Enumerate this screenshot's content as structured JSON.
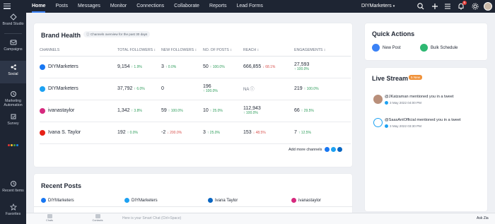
{
  "app": {
    "nav": [
      "Home",
      "Posts",
      "Messages",
      "Monitor",
      "Connections",
      "Collaborate",
      "Reports",
      "Lead Forms"
    ],
    "brand": "DIYMarketers",
    "notification_count": "5",
    "accent": "#3b82f6"
  },
  "sidebar": {
    "items": [
      {
        "label": "Brand Studio",
        "icon": "brand-studio-icon"
      },
      {
        "label": "Campaigns",
        "icon": "campaigns-icon"
      },
      {
        "label": "Social",
        "icon": "social-icon"
      },
      {
        "label": "Marketing Automation",
        "icon": "marketing-automation-icon"
      },
      {
        "label": "Survey",
        "icon": "survey-icon"
      },
      {
        "label": "Recent Items",
        "icon": "recent-items-icon"
      },
      {
        "label": "Favorites",
        "icon": "favorites-icon"
      }
    ]
  },
  "brand_health": {
    "title": "Brand Health",
    "hint": "Channels overview for the past 30 days",
    "columns": [
      "CHANNELS",
      "TOTAL FOLLOWERS",
      "NEW FOLLOWERS",
      "NO. OF POSTS",
      "REACH",
      "ENGAGEMENTS"
    ],
    "rows": [
      {
        "channel": "DIYMarketers",
        "network": "facebook",
        "color": "#1877f2",
        "total": "9,154",
        "total_d": "1.9%",
        "total_dir": "up",
        "new": "3",
        "new_d": "0.0%",
        "new_dir": "up",
        "posts": "50",
        "posts_d": "100.0%",
        "posts_dir": "up",
        "reach": "666,855",
        "reach_d": "68.1%",
        "reach_dir": "dn",
        "eng": "27,593",
        "eng_d": "100.0%",
        "eng_dir": "up"
      },
      {
        "channel": "DIYMarketers",
        "network": "twitter",
        "color": "#1da1f2",
        "total": "37,792",
        "total_d": "6.0%",
        "total_dir": "up",
        "new": "0",
        "new_d": "",
        "new_dir": "",
        "posts": "196",
        "posts_d": "100.0%",
        "posts_dir": "up",
        "reach": "NA",
        "reach_d": "",
        "reach_dir": "",
        "eng": "219",
        "eng_d": "100.0%",
        "eng_dir": "up"
      },
      {
        "channel": "ivanastaylor",
        "network": "instagram",
        "color": "#d6297e",
        "total": "1,342",
        "total_d": "3.8%",
        "total_dir": "up",
        "new": "59",
        "new_d": "100.0%",
        "new_dir": "up",
        "posts": "10",
        "posts_d": "25.0%",
        "posts_dir": "up",
        "reach": "112,943",
        "reach_d": "100.0%",
        "reach_dir": "up",
        "eng": "66",
        "eng_d": "29.5%",
        "eng_dir": "up"
      },
      {
        "channel": "Ivana S. Taylor",
        "network": "youtube",
        "color": "#e62117",
        "total": "192",
        "total_d": "0.0%",
        "total_dir": "up",
        "new": "-2",
        "new_d": "200.0%",
        "new_dir": "dn",
        "posts": "3",
        "posts_d": "25.0%",
        "posts_dir": "up",
        "reach": "153",
        "reach_d": "48.5%",
        "reach_dir": "dn",
        "eng": "7",
        "eng_d": "12.5%",
        "eng_dir": "up"
      }
    ],
    "add_more": "Add more channels"
  },
  "quick_actions": {
    "title": "Quick Actions",
    "new_post": "New Post",
    "bulk_schedule": "Bulk Schedule"
  },
  "live_stream": {
    "title": "Live Stream",
    "badge": "5 New",
    "items": [
      {
        "text": "@JKatzaman mentioned you in a tweet",
        "date": "3 May 2022 04:00 PM"
      },
      {
        "text": "@SaasAntOfficial mentioned you in a tweet",
        "date": "3 May 2022 03:30 PM"
      }
    ]
  },
  "recent_posts": {
    "title": "Recent Posts",
    "tabs": [
      "DIYMarketers",
      "DIYMarketers",
      "Ivana Taylor",
      "ivanastaylor"
    ]
  },
  "bottom": {
    "btn1": "Chats",
    "btn2": "Contacts",
    "smart_placeholder": "Here is your Smart Chat (Ctrl+Space)",
    "ask_zia": "Ask Zia"
  }
}
